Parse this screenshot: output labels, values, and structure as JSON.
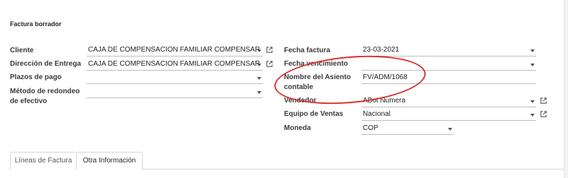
{
  "form": {
    "status_title": "Factura borrador",
    "left": {
      "client_label": "Cliente",
      "client_value": "CAJA DE COMPENSACION FAMILIAR COMPENSAR",
      "delivery_label": "Dirección de Entrega",
      "delivery_value": "CAJA DE COMPENSACION FAMILIAR COMPENSAR",
      "payment_terms_label": "Plazos de pago",
      "payment_terms_value": "",
      "rounding_label_line1": "Método de redondeo",
      "rounding_label_line2": "de efectivo",
      "rounding_value": ""
    },
    "right": {
      "invoice_date_label": "Fecha factura",
      "invoice_date_value": "23-03-2021",
      "due_date_label": "Fecha vencimiento",
      "due_date_value": "",
      "journal_entry_label_line1": "Nombre del Asiento",
      "journal_entry_label_line2": "contable",
      "journal_entry_value": "FV/ADM/1068",
      "salesperson_label": "Vendedor",
      "salesperson_value": "ABot Numera",
      "sales_team_label": "Equipo de Ventas",
      "sales_team_value": "Nacional",
      "currency_label": "Moneda",
      "currency_value": "COP"
    }
  },
  "tabs": [
    {
      "label": "Líneas de Factura",
      "active": false
    },
    {
      "label": "Otra Información",
      "active": true
    }
  ],
  "colors": {
    "annotation": "#d9312f"
  },
  "icons": {
    "dropdown": "caret-down-icon",
    "external": "external-link-icon"
  }
}
